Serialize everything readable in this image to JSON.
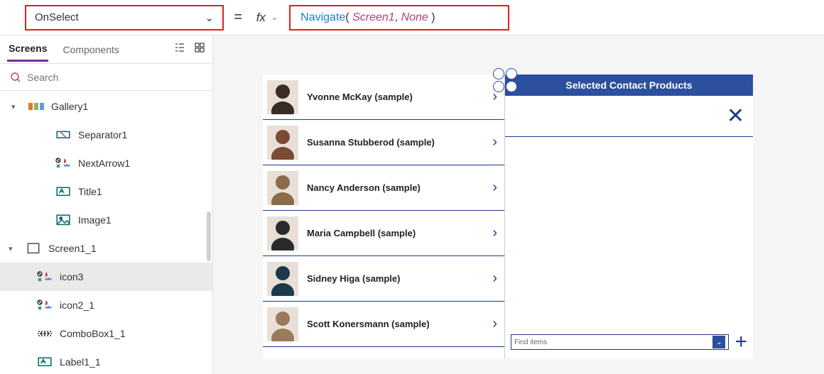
{
  "formula_bar": {
    "property": "OnSelect",
    "equals": "=",
    "fx": "fx",
    "formula": {
      "fn": "Navigate",
      "arg1": "Screen1",
      "arg2": "None"
    }
  },
  "left": {
    "tabs": {
      "screens": "Screens",
      "components": "Components"
    },
    "search_placeholder": "Search",
    "tree": {
      "gallery": "Gallery1",
      "separator": "Separator1",
      "nextarrow": "NextArrow1",
      "title": "Title1",
      "image": "Image1",
      "screen": "Screen1_1",
      "icon3": "icon3",
      "icon2": "icon2_1",
      "combobox": "ComboBox1_1",
      "label": "Label1_1"
    }
  },
  "gallery_items": [
    {
      "name": "Yvonne McKay (sample)"
    },
    {
      "name": "Susanna Stubberod (sample)"
    },
    {
      "name": "Nancy Anderson (sample)"
    },
    {
      "name": "Maria Campbell (sample)"
    },
    {
      "name": "Sidney Higa (sample)"
    },
    {
      "name": "Scott Konersmann (sample)"
    }
  ],
  "right_pane": {
    "title": "Selected Contact Products",
    "combobox_placeholder": "Find items"
  },
  "avatar_colors": [
    "#3a2d25",
    "#7a4a33",
    "#8a6b4a",
    "#2a2a2a",
    "#1a3a4a",
    "#9a7a5a"
  ]
}
